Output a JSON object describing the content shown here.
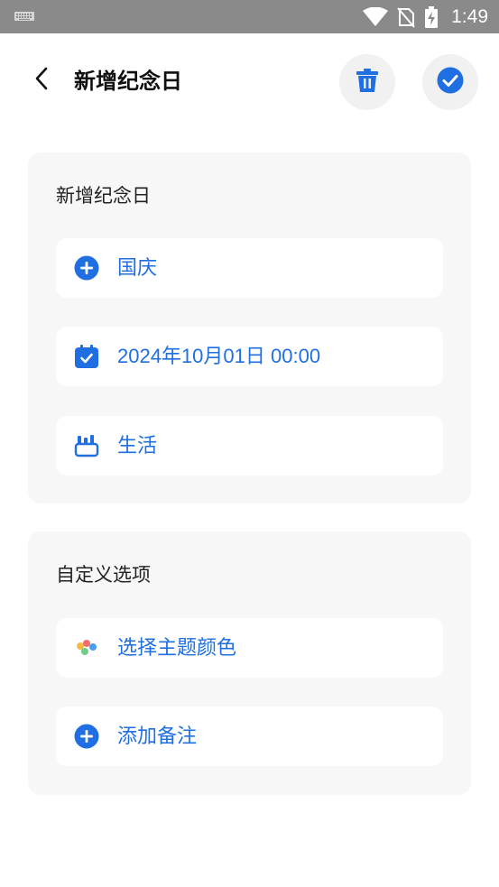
{
  "status_bar": {
    "time": "1:49",
    "icons": [
      "keyboard-icon",
      "wifi-icon",
      "no-sim-icon",
      "battery-charging-icon"
    ]
  },
  "header": {
    "title": "新增纪念日",
    "icons": {
      "back": "chevron-left-icon",
      "delete": "trash-icon",
      "confirm": "check-circle-icon"
    }
  },
  "basic_card": {
    "title": "新增纪念日",
    "name_value": "国庆",
    "date_value": "2024年10月01日 00:00",
    "category_value": "生活"
  },
  "custom_card": {
    "title": "自定义选项",
    "theme_color_label": "选择主题颜色",
    "add_note_label": "添加备注"
  },
  "colors": {
    "accent": "#1f6fe3",
    "card_background": "#f7f7f7",
    "status_bar": "#8a8a8a"
  }
}
